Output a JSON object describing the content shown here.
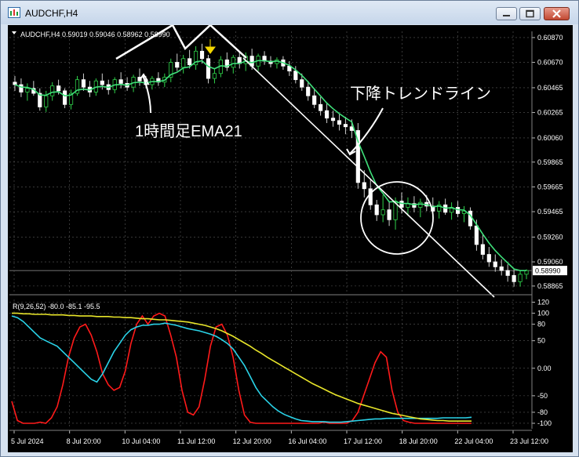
{
  "window": {
    "title": "AUDCHF,H4",
    "controls": [
      "minimize-icon",
      "maximize-icon",
      "close-icon"
    ]
  },
  "chart_data": [
    {
      "type": "candlestick",
      "symbol_header": "AUDCHF,H4  0.59019 0.59046 0.58962 0.58990",
      "current_price": "0.58990",
      "y_ticks": [
        "0.60870",
        "0.60670",
        "0.60465",
        "0.60265",
        "0.60060",
        "0.59865",
        "0.59665",
        "0.59465",
        "0.59260",
        "0.59060",
        "0.58865"
      ],
      "ylim": [
        0.5882,
        0.6092
      ],
      "x_ticks": [
        "5 Jul 2024",
        "8 Jul 20:00",
        "10 Jul 04:00",
        "11 Jul 12:00",
        "12 Jul 20:00",
        "16 Jul 04:00",
        "17 Jul 12:00",
        "18 Jul 20:00",
        "22 Jul 04:00",
        "23 Jul 12:00"
      ],
      "grid": true,
      "candles": [
        [
          0.6051,
          0.6056,
          0.6044,
          0.6049
        ],
        [
          0.6049,
          0.6054,
          0.6039,
          0.6043
        ],
        [
          0.6043,
          0.605,
          0.6036,
          0.6046
        ],
        [
          0.6046,
          0.6052,
          0.604,
          0.6042
        ],
        [
          0.6042,
          0.6046,
          0.6028,
          0.6031
        ],
        [
          0.6031,
          0.6044,
          0.6027,
          0.604
        ],
        [
          0.604,
          0.6051,
          0.6036,
          0.6048
        ],
        [
          0.6048,
          0.6053,
          0.6041,
          0.6044
        ],
        [
          0.6044,
          0.6046,
          0.603,
          0.6033
        ],
        [
          0.6033,
          0.6045,
          0.6029,
          0.6042
        ],
        [
          0.6042,
          0.6056,
          0.604,
          0.6053
        ],
        [
          0.6053,
          0.6058,
          0.6044,
          0.6047
        ],
        [
          0.6047,
          0.6052,
          0.6039,
          0.6043
        ],
        [
          0.6043,
          0.6054,
          0.604,
          0.6052
        ],
        [
          0.6052,
          0.6058,
          0.6045,
          0.6049
        ],
        [
          0.6049,
          0.6053,
          0.6041,
          0.6045
        ],
        [
          0.6045,
          0.6055,
          0.6042,
          0.6053
        ],
        [
          0.6053,
          0.6059,
          0.6046,
          0.605
        ],
        [
          0.605,
          0.6055,
          0.6044,
          0.6047
        ],
        [
          0.6047,
          0.6057,
          0.6043,
          0.6055
        ],
        [
          0.6055,
          0.6062,
          0.6048,
          0.6052
        ],
        [
          0.6052,
          0.6056,
          0.6046,
          0.6049
        ],
        [
          0.6049,
          0.6056,
          0.6045,
          0.6054
        ],
        [
          0.6054,
          0.6059,
          0.6048,
          0.6051
        ],
        [
          0.6051,
          0.6058,
          0.6047,
          0.6055
        ],
        [
          0.6055,
          0.607,
          0.6051,
          0.6067
        ],
        [
          0.6067,
          0.6074,
          0.606,
          0.6063
        ],
        [
          0.6063,
          0.6073,
          0.6058,
          0.607
        ],
        [
          0.607,
          0.6077,
          0.6062,
          0.6065
        ],
        [
          0.6065,
          0.608,
          0.6061,
          0.6076
        ],
        [
          0.6076,
          0.6082,
          0.6066,
          0.607
        ],
        [
          0.607,
          0.6073,
          0.605,
          0.6054
        ],
        [
          0.6054,
          0.6062,
          0.605,
          0.6058
        ],
        [
          0.6058,
          0.6072,
          0.6055,
          0.6069
        ],
        [
          0.6069,
          0.6075,
          0.606,
          0.6063
        ],
        [
          0.6063,
          0.6073,
          0.6058,
          0.6071
        ],
        [
          0.6071,
          0.6076,
          0.6062,
          0.6066
        ],
        [
          0.6066,
          0.6075,
          0.606,
          0.6072
        ],
        [
          0.6072,
          0.6078,
          0.6061,
          0.6064
        ],
        [
          0.6064,
          0.6074,
          0.606,
          0.6072
        ],
        [
          0.6072,
          0.6076,
          0.6065,
          0.6068
        ],
        [
          0.6068,
          0.6072,
          0.6063,
          0.6066
        ],
        [
          0.6066,
          0.6071,
          0.6062,
          0.6069
        ],
        [
          0.6069,
          0.6072,
          0.6061,
          0.6064
        ],
        [
          0.6064,
          0.6068,
          0.6056,
          0.606
        ],
        [
          0.606,
          0.6064,
          0.605,
          0.6053
        ],
        [
          0.6053,
          0.6058,
          0.6044,
          0.6047
        ],
        [
          0.6047,
          0.6052,
          0.6036,
          0.604
        ],
        [
          0.604,
          0.6045,
          0.603,
          0.6033
        ],
        [
          0.6033,
          0.6039,
          0.6024,
          0.6028
        ],
        [
          0.6028,
          0.6034,
          0.6018,
          0.6022
        ],
        [
          0.6022,
          0.6028,
          0.6015,
          0.602
        ],
        [
          0.602,
          0.6025,
          0.6012,
          0.6017
        ],
        [
          0.6017,
          0.6023,
          0.6009,
          0.6015
        ],
        [
          0.6015,
          0.6021,
          0.6006,
          0.6012
        ],
        [
          0.6012,
          0.6018,
          0.5965,
          0.597
        ],
        [
          0.597,
          0.598,
          0.5958,
          0.5965
        ],
        [
          0.5965,
          0.5972,
          0.5948,
          0.5952
        ],
        [
          0.5952,
          0.5956,
          0.5939,
          0.5944
        ],
        [
          0.5944,
          0.596,
          0.5938,
          0.5948
        ],
        [
          0.5948,
          0.5955,
          0.5935,
          0.594
        ],
        [
          0.594,
          0.5958,
          0.5932,
          0.5955
        ],
        [
          0.5955,
          0.5962,
          0.5945,
          0.595
        ],
        [
          0.595,
          0.5958,
          0.5943,
          0.5953
        ],
        [
          0.5953,
          0.5959,
          0.5946,
          0.595
        ],
        [
          0.595,
          0.5957,
          0.5942,
          0.5954
        ],
        [
          0.5954,
          0.596,
          0.5947,
          0.5951
        ],
        [
          0.5951,
          0.5958,
          0.5944,
          0.5947
        ],
        [
          0.5947,
          0.5955,
          0.5941,
          0.5952
        ],
        [
          0.5952,
          0.5957,
          0.5944,
          0.5946
        ],
        [
          0.5946,
          0.5954,
          0.594,
          0.595
        ],
        [
          0.595,
          0.5955,
          0.5942,
          0.5945
        ],
        [
          0.5945,
          0.5951,
          0.5938,
          0.5947
        ],
        [
          0.5947,
          0.595,
          0.5932,
          0.5935
        ],
        [
          0.5935,
          0.594,
          0.5915,
          0.592
        ],
        [
          0.592,
          0.5928,
          0.5908,
          0.5912
        ],
        [
          0.5912,
          0.5918,
          0.5902,
          0.5906
        ],
        [
          0.5906,
          0.5912,
          0.5898,
          0.5902
        ],
        [
          0.5902,
          0.5908,
          0.5895,
          0.5899
        ],
        [
          0.5899,
          0.5904,
          0.589,
          0.5895
        ],
        [
          0.5895,
          0.59,
          0.5886,
          0.589
        ],
        [
          0.589,
          0.5899,
          0.5886,
          0.5896
        ],
        [
          0.5896,
          0.59,
          0.5892,
          0.5899
        ]
      ],
      "indicator": {
        "label": "R(9,26,52) -80.0 -85.1 -95.5",
        "y_ticks": [
          "120",
          "100",
          "80",
          "50",
          "0.00",
          "-50",
          "-80",
          "-100"
        ],
        "ylim": [
          -110,
          125
        ],
        "series": [
          {
            "color": "#ff1a1a",
            "values": [
              -60,
              -95,
              -100,
              -100,
              -100,
              -98,
              -100,
              -90,
              -70,
              -30,
              20,
              55,
              75,
              80,
              60,
              30,
              -10,
              -30,
              -40,
              -35,
              -5,
              45,
              80,
              95,
              80,
              95,
              100,
              95,
              60,
              20,
              -40,
              -80,
              -85,
              -70,
              -20,
              40,
              75,
              80,
              60,
              20,
              -40,
              -85,
              -98,
              -100,
              -100,
              -100,
              -100,
              -100,
              -100,
              -100,
              -100,
              -100,
              -100,
              -100,
              -100,
              -98,
              -100,
              -100,
              -100,
              -100,
              -95,
              -80,
              -50,
              -20,
              10,
              30,
              20,
              -40,
              -80,
              -95,
              -98,
              -100,
              -100,
              -100,
              -100,
              -100,
              -100,
              -100,
              -100,
              -100,
              -100,
              -100
            ]
          },
          {
            "color": "#2ad3e8",
            "values": [
              95,
              92,
              85,
              75,
              65,
              55,
              50,
              45,
              40,
              30,
              20,
              10,
              0,
              -10,
              -20,
              -25,
              -10,
              10,
              30,
              45,
              60,
              70,
              75,
              78,
              78,
              80,
              80,
              82,
              80,
              78,
              75,
              72,
              70,
              68,
              65,
              62,
              58,
              52,
              45,
              35,
              20,
              5,
              -15,
              -35,
              -50,
              -60,
              -70,
              -78,
              -84,
              -88,
              -92,
              -95,
              -96,
              -97,
              -97,
              -97,
              -98,
              -98,
              -98,
              -97,
              -96,
              -95,
              -94,
              -93,
              -92,
              -92,
              -91,
              -91,
              -91,
              -91,
              -91,
              -91,
              -91,
              -91,
              -91,
              -91,
              -90,
              -90,
              -90,
              -90,
              -90,
              -89
            ]
          },
          {
            "color": "#e8e52a",
            "values": [
              100,
              100,
              99,
              99,
              98,
              98,
              98,
              97,
              97,
              97,
              96,
              96,
              95,
              95,
              95,
              94,
              94,
              94,
              93,
              93,
              92,
              92,
              91,
              90,
              90,
              89,
              88,
              88,
              87,
              86,
              85,
              84,
              82,
              80,
              78,
              75,
              72,
              68,
              63,
              58,
              52,
              46,
              40,
              33,
              27,
              20,
              14,
              8,
              2,
              -4,
              -10,
              -16,
              -22,
              -28,
              -33,
              -38,
              -43,
              -48,
              -52,
              -56,
              -60,
              -64,
              -67,
              -70,
              -73,
              -76,
              -79,
              -82,
              -84,
              -86,
              -88,
              -90,
              -92,
              -93,
              -94,
              -95,
              -95,
              -96,
              -96,
              -96,
              -96,
              -96
            ]
          }
        ]
      },
      "annotations": {
        "ema_label": "1時間足EMA21",
        "trend_label": "下降トレンドライン"
      }
    }
  ]
}
